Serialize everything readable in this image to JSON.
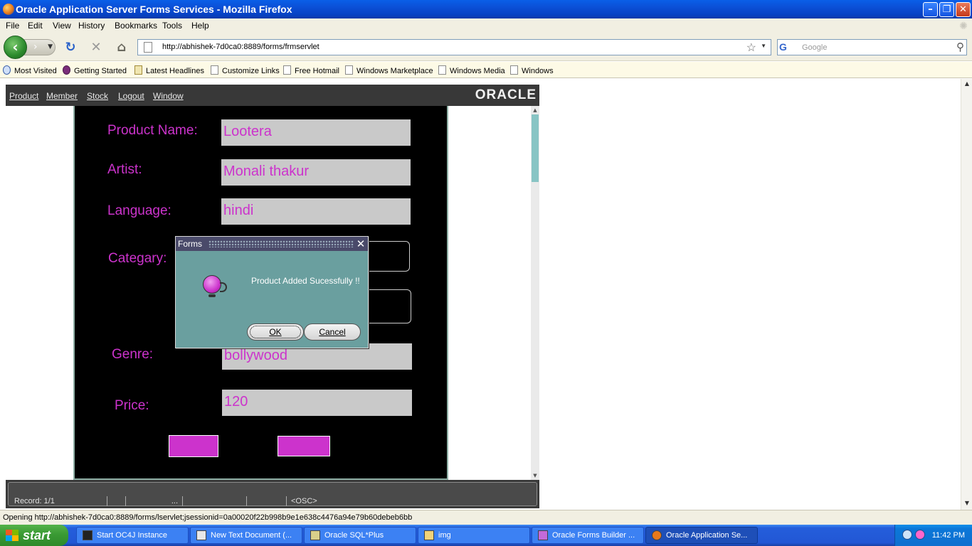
{
  "window": {
    "title": "Oracle Application Server Forms Services - Mozilla Firefox"
  },
  "menubar": {
    "items": [
      "File",
      "Edit",
      "View",
      "History",
      "Bookmarks",
      "Tools",
      "Help"
    ]
  },
  "navbar": {
    "url": "http://abhishek-7d0ca0:8889/forms/frmservlet",
    "search_engine": "G",
    "search_placeholder": "Google"
  },
  "bookmarks": {
    "items": [
      "Most Visited",
      "Getting Started",
      "Latest Headlines",
      "Customize Links",
      "Free Hotmail",
      "Windows Marketplace",
      "Windows Media",
      "Windows"
    ]
  },
  "applet": {
    "menu": [
      "Product",
      "Member",
      "Stock",
      "Logout",
      "Window"
    ],
    "brand": "ORACLE",
    "form": {
      "product_name_label": "Product Name:",
      "product_name_value": "Lootera",
      "artist_label": "Artist:",
      "artist_value": "Monali thakur",
      "language_label": "Language:",
      "language_value": "hindi",
      "category_label": "Categary:",
      "genre_label": "Genre:",
      "genre_value": "bollywood",
      "price_label": "Price:",
      "price_value": "120"
    },
    "status": {
      "record": "Record: 1/1",
      "ellipsis": "...",
      "osc": "<OSC>"
    }
  },
  "dialog": {
    "title": "Forms",
    "message": "Product Added Sucessfully !!",
    "ok_label": "OK",
    "cancel_label": "Cancel"
  },
  "firefox_status": {
    "text": "Opening http://abhishek-7d0ca0:8889/forms/lservlet;jsessionid=0a00020f22b998b9e1e638c4476a94e79b60debeb6bb"
  },
  "taskbar": {
    "start_label": "start",
    "tasks": [
      "Start OC4J Instance",
      "New Text Document (...",
      "Oracle SQL*Plus",
      "img",
      "Oracle Forms Builder ...",
      "Oracle Application Se..."
    ],
    "clock": "11:42 PM"
  },
  "colors": {
    "accent_magenta": "#cc33cc",
    "titlebar_blue": "#0b4fd6",
    "dialog_teal": "#6a9f9f"
  }
}
